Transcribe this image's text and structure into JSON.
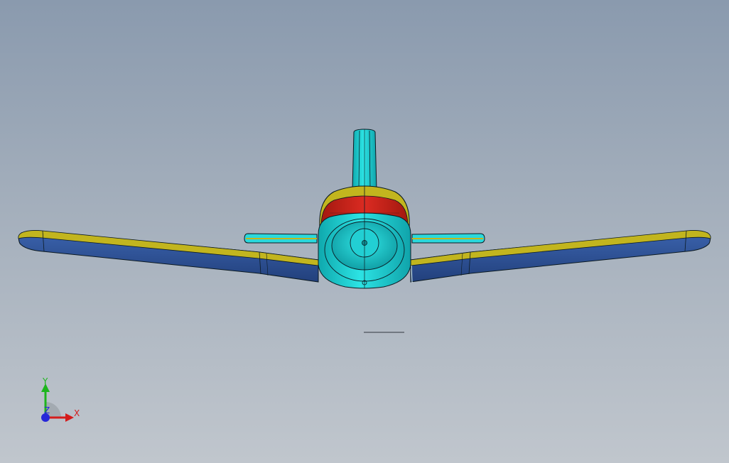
{
  "viewport": {
    "background_top": "#8a9aae",
    "background_bottom": "#c0c6cd"
  },
  "model": {
    "colors": {
      "fuselage": "#1fd3d6",
      "canopy": "#c8231f",
      "wing_bottom": "#3a5fa8",
      "wing_edge": "#c2b51e",
      "outline": "#0c1a22"
    }
  },
  "triad": {
    "x_label": "X",
    "y_label": "Y",
    "z_label": "Z",
    "x_color": "#d41c1c",
    "y_color": "#1db51d",
    "z_color": "#2626d9"
  }
}
